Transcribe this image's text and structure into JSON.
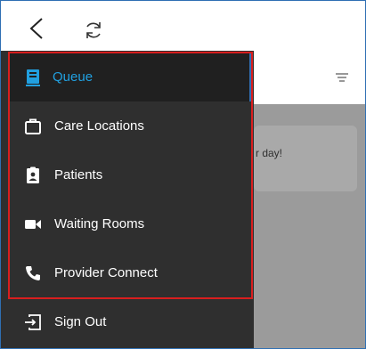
{
  "toolbar": {
    "back_icon": "chevron-left-icon",
    "refresh_icon": "refresh-icon"
  },
  "drawer": {
    "items": [
      {
        "label": "Queue",
        "icon": "clipboard-list-icon",
        "active": true
      },
      {
        "label": "Care Locations",
        "icon": "briefcase-icon",
        "active": false
      },
      {
        "label": "Patients",
        "icon": "patient-badge-icon",
        "active": false
      },
      {
        "label": "Waiting Rooms",
        "icon": "video-camera-icon",
        "active": false
      },
      {
        "label": "Provider Connect",
        "icon": "phone-icon",
        "active": false
      }
    ],
    "signout": {
      "label": "Sign Out",
      "icon": "sign-out-icon"
    }
  },
  "main": {
    "filter_icon": "filter-icon",
    "message_fragment": "r day!"
  },
  "colors": {
    "drawer_bg": "#2f2f2f",
    "active_bg": "#202020",
    "accent": "#21a0e0",
    "highlight": "#d81e1e",
    "frame_border": "#2f6fb3"
  }
}
